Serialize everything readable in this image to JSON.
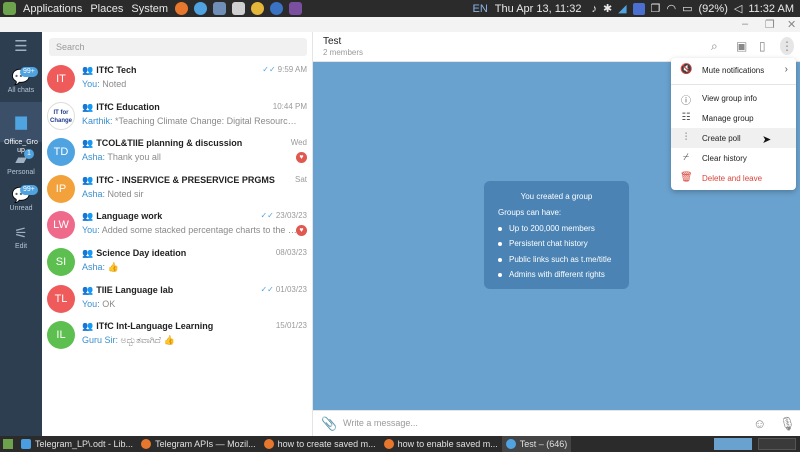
{
  "system_bar": {
    "menus": [
      "Applications",
      "Places",
      "System"
    ],
    "clock": "Thu Apr 13, 11:32",
    "battery": "(92%)",
    "time_right": "11:32 AM",
    "keyboard": "EN"
  },
  "sidebar": {
    "items": [
      {
        "label": "All chats",
        "badge": "99+",
        "icon": "chat-bubbles-icon"
      },
      {
        "label": "Office_Gro\nup",
        "badge": "",
        "icon": "folder-icon"
      },
      {
        "label": "Personal",
        "badge": "1",
        "icon": "person-chat-icon"
      },
      {
        "label": "Unread",
        "badge": "99+",
        "icon": "unread-icon"
      },
      {
        "label": "Edit",
        "badge": "",
        "icon": "sliders-icon"
      }
    ]
  },
  "search": {
    "placeholder": "Search"
  },
  "chats": [
    {
      "initials": "IT",
      "color": "#ef5b5b",
      "name": "ITfC Tech",
      "group": true,
      "time": "9:59 AM",
      "checks": "✓✓",
      "sender": "You:",
      "message": "Noted",
      "heart": false
    },
    {
      "initials": "",
      "color": "#ffffff",
      "name": "ITfC Education",
      "group": true,
      "time": "10:44 PM",
      "checks": "",
      "sender": "Karthik:",
      "message": "*Teaching Climate Change: Digital Resources for the ...",
      "heart": false,
      "logo": "IT for Change"
    },
    {
      "initials": "TD",
      "color": "#4fa3e0",
      "name": "TCOL&TIIE planning & discussion",
      "group": true,
      "time": "Wed",
      "checks": "",
      "sender": "Asha:",
      "message": "Thank you all",
      "heart": true
    },
    {
      "initials": "IP",
      "color": "#f2a13b",
      "name": "ITfC - INSERVICE & PRESERVICE PRGMS",
      "group": true,
      "time": "Sat",
      "checks": "",
      "sender": "Asha:",
      "message": "Noted sir",
      "heart": false
    },
    {
      "initials": "LW",
      "color": "#ef6a8a",
      "name": "Language work",
      "group": true,
      "time": "23/03/23",
      "checks": "✓✓",
      "sender": "You:",
      "message": "Added some stacked percentage charts to the end o...",
      "heart": true
    },
    {
      "initials": "SI",
      "color": "#5cbf4f",
      "name": "Science Day ideation",
      "group": true,
      "time": "08/03/23",
      "checks": "",
      "sender": "Asha:",
      "message": "👍",
      "heart": false
    },
    {
      "initials": "TL",
      "color": "#ef5b5b",
      "name": "TIIE Language lab",
      "group": true,
      "time": "01/03/23",
      "checks": "✓✓",
      "sender": "You:",
      "message": "OK",
      "heart": false
    },
    {
      "initials": "IL",
      "color": "#5cbf4f",
      "name": "ITfC Int-Language Learning",
      "group": true,
      "time": "15/01/23",
      "checks": "",
      "sender": "Guru Sir:",
      "message": "ಅದ್ಭುತವಾಗಿದೆ 👍",
      "heart": false
    }
  ],
  "conversation": {
    "title": "Test",
    "subtitle": "2 members",
    "card": {
      "title": "You created a group",
      "heading": "Groups can have:",
      "items": [
        "Up to 200,000 members",
        "Persistent chat history",
        "Public links such as t.me/title",
        "Admins with different rights"
      ]
    },
    "composer_placeholder": "Write a message..."
  },
  "menu": {
    "items": [
      {
        "label": "Mute notifications",
        "icon": "mute-icon",
        "submenu": true
      },
      {
        "label": "View group info",
        "icon": "info-icon"
      },
      {
        "label": "Manage group",
        "icon": "manage-icon"
      },
      {
        "label": "Create poll",
        "icon": "poll-icon"
      },
      {
        "label": "Clear history",
        "icon": "broom-icon"
      },
      {
        "label": "Delete and leave",
        "icon": "trash-icon",
        "danger": true
      }
    ]
  },
  "taskbar": {
    "items": [
      {
        "label": "Telegram_LP\\.odt - Lib...",
        "color": "#4a9de0"
      },
      {
        "label": "Telegram APIs — Mozil...",
        "color": "#e8772e"
      },
      {
        "label": "how to create saved m...",
        "color": "#e8772e"
      },
      {
        "label": "how to enable saved m...",
        "color": "#e8772e"
      },
      {
        "label": "Test – (646)",
        "color": "#4fa3e0"
      }
    ]
  }
}
